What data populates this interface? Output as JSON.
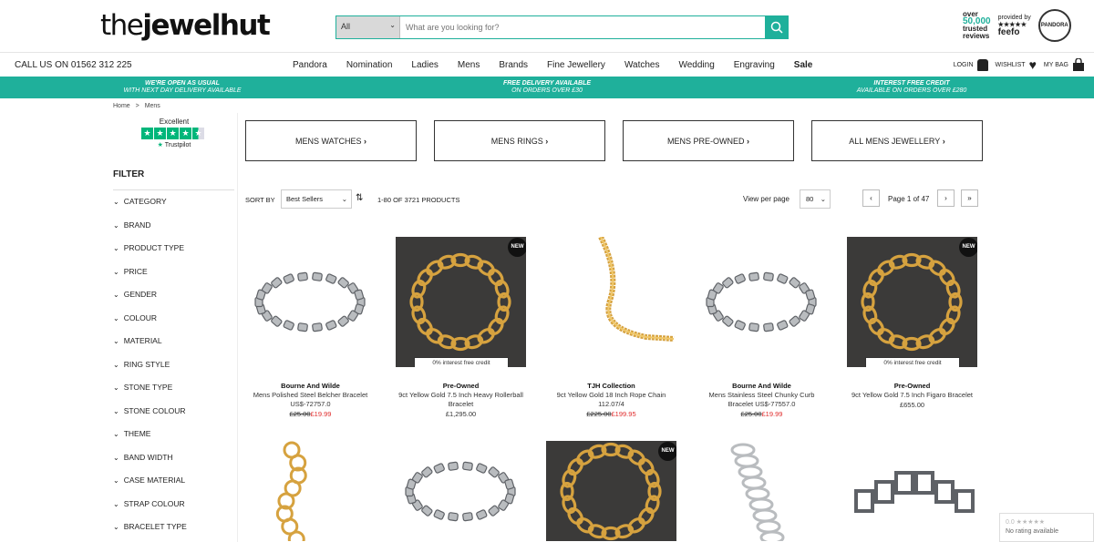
{
  "header": {
    "logo_pre": "the",
    "logo_main": "jewelhut",
    "search": {
      "category": "All",
      "placeholder": "What are you looking for?"
    },
    "badges": {
      "reviews_top": "over",
      "reviews_num": "50,000",
      "reviews_l1": "trusted",
      "reviews_l2": "reviews",
      "feefo_label": "provided by",
      "feefo_stars": "★★★★★",
      "feefo_name": "feefo",
      "pandora": "PANDORA"
    }
  },
  "nav": {
    "call": "CALL US ON 01562 312 225",
    "items": [
      "Pandora",
      "Nomination",
      "Ladies",
      "Mens",
      "Brands",
      "Fine Jewellery",
      "Watches",
      "Wedding",
      "Engraving",
      "Sale"
    ],
    "login": "LOGIN",
    "wishlist": "WISHLIST",
    "bag": "MY BAG"
  },
  "strip": [
    {
      "l1": "WE'RE OPEN AS USUAL",
      "l2": "WITH NEXT DAY DELIVERY AVAILABLE"
    },
    {
      "l1": "FREE DELIVERY AVAILABLE",
      "l2": "ON ORDERS OVER £30"
    },
    {
      "l1": "INTEREST FREE CREDIT",
      "l2": "AVAILABLE ON ORDERS OVER £280"
    }
  ],
  "breadcrumb": {
    "home": "Home",
    "sep": ">",
    "current": "Mens"
  },
  "trustpilot": {
    "rating_word": "Excellent",
    "brand": "Trustpilot",
    "stars": 4.5
  },
  "filter": {
    "title": "FILTER",
    "items": [
      "CATEGORY",
      "BRAND",
      "PRODUCT TYPE",
      "PRICE",
      "GENDER",
      "COLOUR",
      "MATERIAL",
      "RING STYLE",
      "STONE TYPE",
      "STONE COLOUR",
      "THEME",
      "BAND WIDTH",
      "CASE MATERIAL",
      "STRAP COLOUR",
      "BRACELET TYPE"
    ]
  },
  "categories": [
    "MENS WATCHES",
    "MENS RINGS",
    "MENS PRE-OWNED",
    "ALL MENS JEWELLERY"
  ],
  "sortbar": {
    "sort_label": "SORT BY",
    "sort_value": "Best Sellers",
    "count": "1-80 OF 3721 PRODUCTS",
    "view_label": "View per page",
    "view_value": "80",
    "page_text": "Page 1 of 47",
    "prev": "‹",
    "next": "›",
    "last": "»"
  },
  "products": [
    {
      "brand": "Bourne And Wilde",
      "name": "Mens Polished Steel Belcher Bracelet US$-72757.0",
      "old_price": "£25.00",
      "new_price": "£19.99",
      "price": "",
      "new": false,
      "credit": "",
      "dark": false,
      "style": "silver-box"
    },
    {
      "brand": "Pre-Owned",
      "name": "9ct Yellow Gold 7.5 Inch Heavy Rollerball Bracelet",
      "old_price": "",
      "new_price": "",
      "price": "£1,295.00",
      "new": true,
      "credit": "0% interest free credit",
      "dark": true,
      "style": "gold-round"
    },
    {
      "brand": "TJH Collection",
      "name": "9ct Yellow Gold 18 Inch Rope Chain 112.07/4",
      "old_price": "£225.00",
      "new_price": "£199.95",
      "price": "",
      "new": false,
      "credit": "",
      "dark": false,
      "style": "gold-rope"
    },
    {
      "brand": "Bourne And Wilde",
      "name": "Mens Stainless Steel Chunky Curb Bracelet US$-77557.0",
      "old_price": "£25.00",
      "new_price": "£19.99",
      "price": "",
      "new": false,
      "credit": "",
      "dark": false,
      "style": "silver-curb"
    },
    {
      "brand": "Pre-Owned",
      "name": "9ct Yellow Gold 7.5 Inch Figaro Bracelet",
      "old_price": "",
      "new_price": "",
      "price": "£655.00",
      "new": true,
      "credit": "0% interest free credit",
      "dark": true,
      "style": "gold-figaro"
    }
  ],
  "products_row2": [
    {
      "new": false,
      "dark": false,
      "style": "gold-belcher"
    },
    {
      "new": false,
      "dark": false,
      "style": "silver-curb2"
    },
    {
      "new": true,
      "dark": true,
      "style": "gold-figaro2"
    },
    {
      "new": false,
      "dark": false,
      "style": "silver-chain"
    },
    {
      "new": false,
      "dark": false,
      "style": "silver-box2"
    }
  ],
  "rating_widget": {
    "score": "0.0 ★★★★★",
    "text": "No rating available"
  },
  "colors": {
    "accent": "#1fb09b",
    "sale_red": "#e02b2b"
  }
}
